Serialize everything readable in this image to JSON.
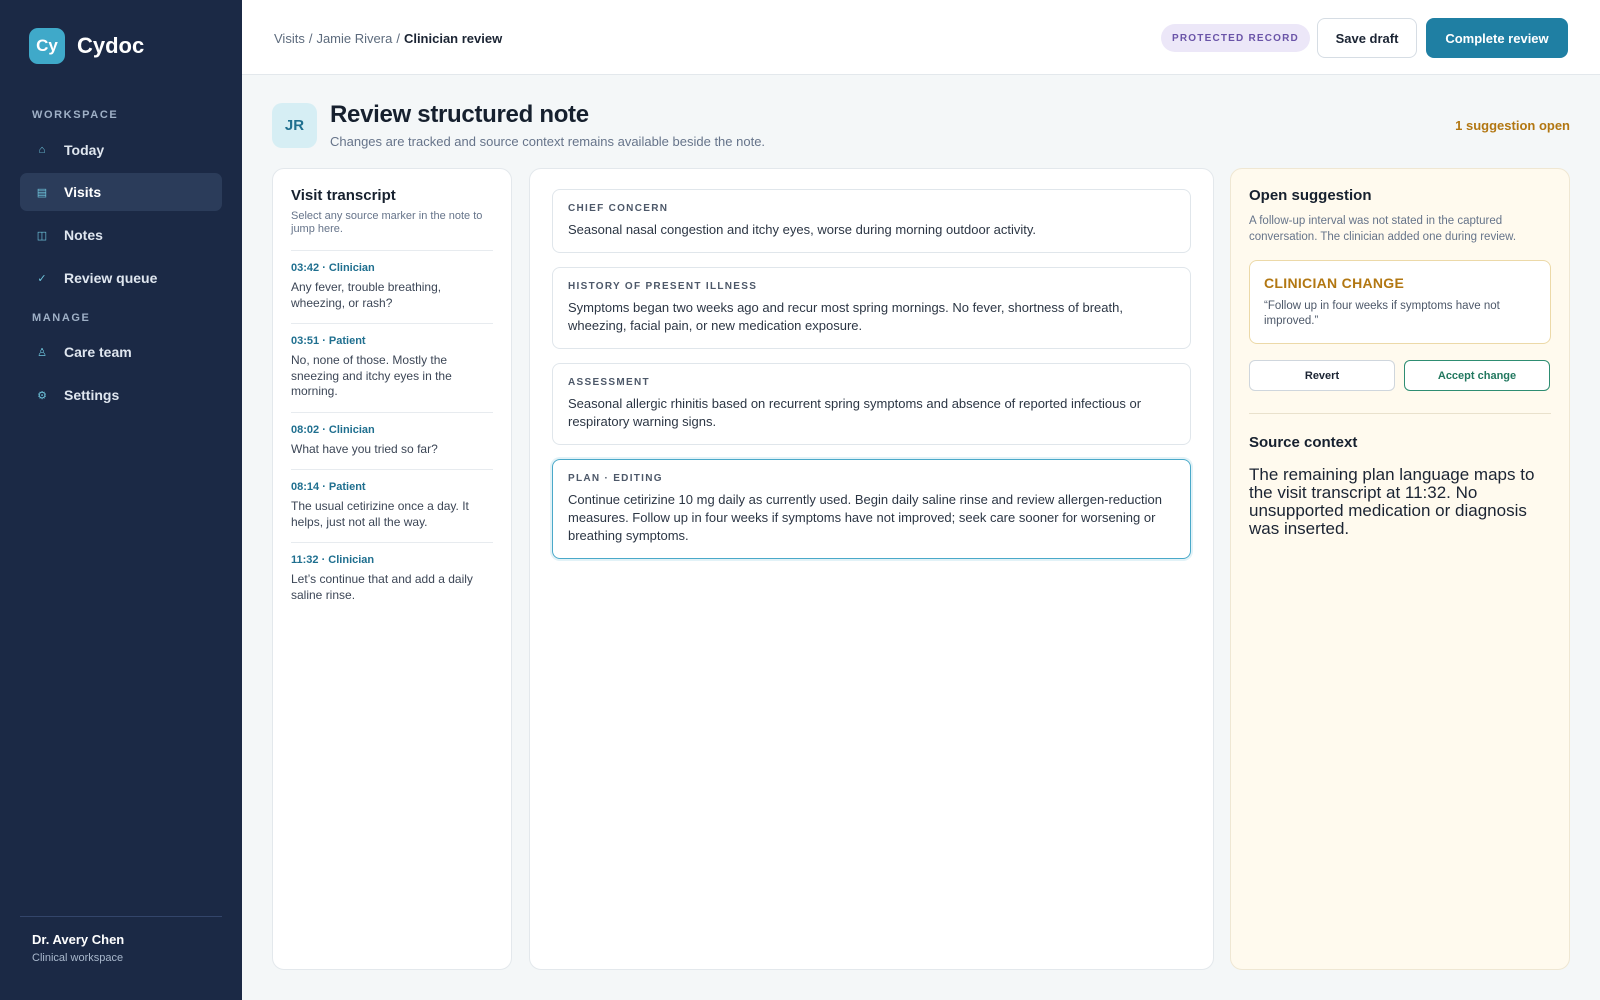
{
  "brand": {
    "logo": "Cy",
    "name": "Cydoc"
  },
  "sidebar": {
    "workspace_label": "WORKSPACE",
    "manage_label": "MANAGE",
    "items": [
      {
        "label": "Today",
        "icon": "home-icon",
        "glyph": "⌂"
      },
      {
        "label": "Visits",
        "icon": "list-icon",
        "glyph": "▤",
        "active": true
      },
      {
        "label": "Notes",
        "icon": "notes-icon",
        "glyph": "◫"
      },
      {
        "label": "Review queue",
        "icon": "check-icon",
        "glyph": "✓"
      },
      {
        "label": "Care team",
        "icon": "person-icon",
        "glyph": "♙"
      },
      {
        "label": "Settings",
        "icon": "gear-icon",
        "glyph": "⚙"
      }
    ],
    "user": {
      "name": "Dr. Avery Chen",
      "role": "Clinical workspace"
    }
  },
  "header": {
    "breadcrumb": [
      "Visits",
      "/",
      "Jamie Rivera",
      "/",
      "Clinician review"
    ],
    "badge": "PROTECTED RECORD",
    "save_label": "Save draft",
    "complete_label": "Complete review"
  },
  "page": {
    "avatar": "JR",
    "title": "Review structured note",
    "subtitle": "Changes are tracked and source context remains available beside the note.",
    "suggestion_count": "1 suggestion open"
  },
  "transcript": {
    "title": "Visit transcript",
    "help": "Select any source marker in the note to jump here.",
    "entries": [
      {
        "meta": "03:42 · Clinician",
        "text": "Any fever, trouble breathing, wheezing, or rash?"
      },
      {
        "meta": "03:51 · Patient",
        "text": "No, none of those. Mostly the sneezing and itchy eyes in the morning."
      },
      {
        "meta": "08:02 · Clinician",
        "text": "What have you tried so far?"
      },
      {
        "meta": "08:14 · Patient",
        "text": "The usual cetirizine once a day. It helps, just not all the way."
      },
      {
        "meta": "11:32 · Clinician",
        "text": "Let’s continue that and add a daily saline rinse."
      }
    ]
  },
  "note": {
    "sections": [
      {
        "label": "CHIEF CONCERN",
        "text": "Seasonal nasal congestion and itchy eyes, worse during morning outdoor activity."
      },
      {
        "label": "HISTORY OF PRESENT ILLNESS",
        "text": "Symptoms began two weeks ago and recur most spring mornings. No fever, shortness of breath, wheezing, facial pain, or new medication exposure."
      },
      {
        "label": "ASSESSMENT",
        "text": "Seasonal allergic rhinitis based on recurrent spring symptoms and absence of reported infectious or respiratory warning signs."
      },
      {
        "label": "PLAN · EDITING",
        "text": "Continue cetirizine 10 mg daily as currently used. Begin daily saline rinse and review allergen-reduction measures. Follow up in four weeks if symptoms have not improved; seek care sooner for worsening or breathing symptoms."
      }
    ]
  },
  "suggestion": {
    "title": "Open suggestion",
    "description": "A follow-up interval was not stated in the captured conversation. The clinician added one during review.",
    "change_title": "CLINICIAN CHANGE",
    "change_text": "“Follow up in four weeks if symptoms have not improved.”",
    "revert_label": "Revert",
    "accept_label": "Accept change",
    "source_title": "Source context",
    "source_text": "The remaining plan language maps to the visit transcript at 11:32. No unsupported medication or diagnosis was inserted."
  },
  "colors": {
    "sidebar_bg": "#1b2945",
    "accent": "#1f7fa3",
    "warning": "#b27712",
    "badge_bg": "#ece7f8",
    "accept": "#22785f"
  }
}
